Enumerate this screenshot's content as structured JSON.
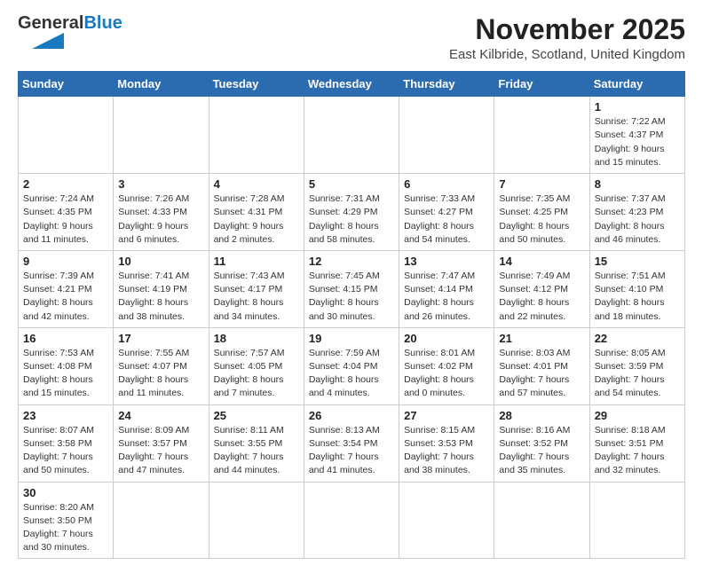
{
  "header": {
    "logo_text_general": "General",
    "logo_text_blue": "Blue",
    "month_title": "November 2025",
    "location": "East Kilbride, Scotland, United Kingdom"
  },
  "weekdays": [
    "Sunday",
    "Monday",
    "Tuesday",
    "Wednesday",
    "Thursday",
    "Friday",
    "Saturday"
  ],
  "weeks": [
    [
      {
        "day": "",
        "info": ""
      },
      {
        "day": "",
        "info": ""
      },
      {
        "day": "",
        "info": ""
      },
      {
        "day": "",
        "info": ""
      },
      {
        "day": "",
        "info": ""
      },
      {
        "day": "",
        "info": ""
      },
      {
        "day": "1",
        "info": "Sunrise: 7:22 AM\nSunset: 4:37 PM\nDaylight: 9 hours\nand 15 minutes."
      }
    ],
    [
      {
        "day": "2",
        "info": "Sunrise: 7:24 AM\nSunset: 4:35 PM\nDaylight: 9 hours\nand 11 minutes."
      },
      {
        "day": "3",
        "info": "Sunrise: 7:26 AM\nSunset: 4:33 PM\nDaylight: 9 hours\nand 6 minutes."
      },
      {
        "day": "4",
        "info": "Sunrise: 7:28 AM\nSunset: 4:31 PM\nDaylight: 9 hours\nand 2 minutes."
      },
      {
        "day": "5",
        "info": "Sunrise: 7:31 AM\nSunset: 4:29 PM\nDaylight: 8 hours\nand 58 minutes."
      },
      {
        "day": "6",
        "info": "Sunrise: 7:33 AM\nSunset: 4:27 PM\nDaylight: 8 hours\nand 54 minutes."
      },
      {
        "day": "7",
        "info": "Sunrise: 7:35 AM\nSunset: 4:25 PM\nDaylight: 8 hours\nand 50 minutes."
      },
      {
        "day": "8",
        "info": "Sunrise: 7:37 AM\nSunset: 4:23 PM\nDaylight: 8 hours\nand 46 minutes."
      }
    ],
    [
      {
        "day": "9",
        "info": "Sunrise: 7:39 AM\nSunset: 4:21 PM\nDaylight: 8 hours\nand 42 minutes."
      },
      {
        "day": "10",
        "info": "Sunrise: 7:41 AM\nSunset: 4:19 PM\nDaylight: 8 hours\nand 38 minutes."
      },
      {
        "day": "11",
        "info": "Sunrise: 7:43 AM\nSunset: 4:17 PM\nDaylight: 8 hours\nand 34 minutes."
      },
      {
        "day": "12",
        "info": "Sunrise: 7:45 AM\nSunset: 4:15 PM\nDaylight: 8 hours\nand 30 minutes."
      },
      {
        "day": "13",
        "info": "Sunrise: 7:47 AM\nSunset: 4:14 PM\nDaylight: 8 hours\nand 26 minutes."
      },
      {
        "day": "14",
        "info": "Sunrise: 7:49 AM\nSunset: 4:12 PM\nDaylight: 8 hours\nand 22 minutes."
      },
      {
        "day": "15",
        "info": "Sunrise: 7:51 AM\nSunset: 4:10 PM\nDaylight: 8 hours\nand 18 minutes."
      }
    ],
    [
      {
        "day": "16",
        "info": "Sunrise: 7:53 AM\nSunset: 4:08 PM\nDaylight: 8 hours\nand 15 minutes."
      },
      {
        "day": "17",
        "info": "Sunrise: 7:55 AM\nSunset: 4:07 PM\nDaylight: 8 hours\nand 11 minutes."
      },
      {
        "day": "18",
        "info": "Sunrise: 7:57 AM\nSunset: 4:05 PM\nDaylight: 8 hours\nand 7 minutes."
      },
      {
        "day": "19",
        "info": "Sunrise: 7:59 AM\nSunset: 4:04 PM\nDaylight: 8 hours\nand 4 minutes."
      },
      {
        "day": "20",
        "info": "Sunrise: 8:01 AM\nSunset: 4:02 PM\nDaylight: 8 hours\nand 0 minutes."
      },
      {
        "day": "21",
        "info": "Sunrise: 8:03 AM\nSunset: 4:01 PM\nDaylight: 7 hours\nand 57 minutes."
      },
      {
        "day": "22",
        "info": "Sunrise: 8:05 AM\nSunset: 3:59 PM\nDaylight: 7 hours\nand 54 minutes."
      }
    ],
    [
      {
        "day": "23",
        "info": "Sunrise: 8:07 AM\nSunset: 3:58 PM\nDaylight: 7 hours\nand 50 minutes."
      },
      {
        "day": "24",
        "info": "Sunrise: 8:09 AM\nSunset: 3:57 PM\nDaylight: 7 hours\nand 47 minutes."
      },
      {
        "day": "25",
        "info": "Sunrise: 8:11 AM\nSunset: 3:55 PM\nDaylight: 7 hours\nand 44 minutes."
      },
      {
        "day": "26",
        "info": "Sunrise: 8:13 AM\nSunset: 3:54 PM\nDaylight: 7 hours\nand 41 minutes."
      },
      {
        "day": "27",
        "info": "Sunrise: 8:15 AM\nSunset: 3:53 PM\nDaylight: 7 hours\nand 38 minutes."
      },
      {
        "day": "28",
        "info": "Sunrise: 8:16 AM\nSunset: 3:52 PM\nDaylight: 7 hours\nand 35 minutes."
      },
      {
        "day": "29",
        "info": "Sunrise: 8:18 AM\nSunset: 3:51 PM\nDaylight: 7 hours\nand 32 minutes."
      }
    ],
    [
      {
        "day": "30",
        "info": "Sunrise: 8:20 AM\nSunset: 3:50 PM\nDaylight: 7 hours\nand 30 minutes."
      },
      {
        "day": "",
        "info": ""
      },
      {
        "day": "",
        "info": ""
      },
      {
        "day": "",
        "info": ""
      },
      {
        "day": "",
        "info": ""
      },
      {
        "day": "",
        "info": ""
      },
      {
        "day": "",
        "info": ""
      }
    ]
  ]
}
